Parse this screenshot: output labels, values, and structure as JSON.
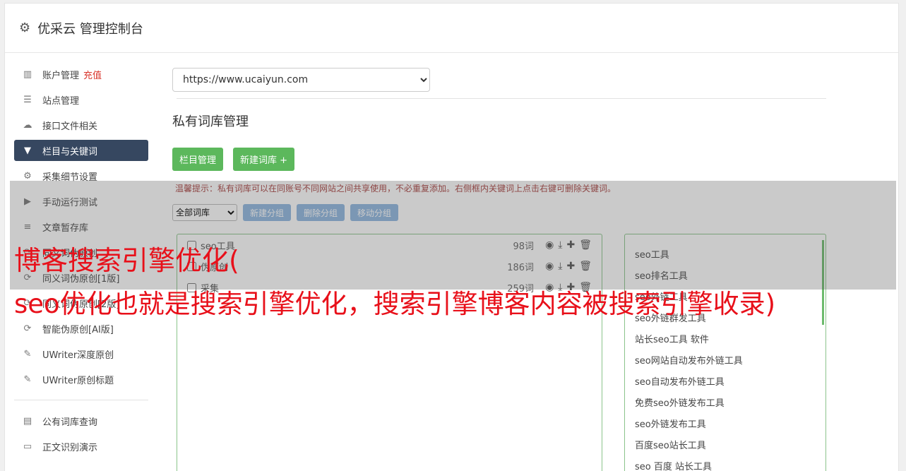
{
  "header": {
    "title": "优采云 管理控制台",
    "icon": "gear-icon"
  },
  "sidebar": {
    "items": [
      {
        "label": "账户管理",
        "badge": "充值",
        "icon": "bar-chart-icon"
      },
      {
        "label": "站点管理",
        "icon": "server-icon"
      },
      {
        "label": "接口文件相关",
        "icon": "cloud-upload-icon"
      },
      {
        "label": "栏目与关键词",
        "icon": "filter-icon",
        "active": true
      },
      {
        "label": "采集细节设置",
        "icon": "cogs-icon"
      },
      {
        "label": "手动运行测试",
        "icon": "play-icon"
      },
      {
        "label": "文章暂存库",
        "icon": "database-icon"
      },
      {
        "label": "同义词伪原创",
        "icon": "refresh-icon"
      },
      {
        "label": "同义词伪原创[1版]",
        "icon": "refresh-icon"
      },
      {
        "label": "同义词伪原创[2版]",
        "icon": "refresh-icon"
      },
      {
        "label": "智能伪原创[AI版]",
        "icon": "refresh-icon"
      },
      {
        "label": "UWriter深度原创",
        "icon": "edit-icon"
      },
      {
        "label": "UWriter原创标题",
        "icon": "edit-icon"
      }
    ],
    "items2": [
      {
        "label": "公有词库查询",
        "icon": "book-icon"
      },
      {
        "label": "正文识别演示",
        "icon": "monitor-icon"
      }
    ]
  },
  "main": {
    "site_select": "https://www.ucaiyun.com",
    "section_title": "私有词库管理",
    "btn_columns": "栏目管理",
    "btn_new_lib": "新建词库 +",
    "tip": "温馨提示：私有词库可以在同账号不同网站之间共享使用，不必重复添加。右侧框内关键词上点击右键可删除关键词。",
    "lib_select": "全部词库",
    "btn_new_group": "新建分组",
    "btn_delete_group": "删除分组",
    "btn_move_group": "移动分组"
  },
  "categories": [
    {
      "name": "seo工具",
      "count": "98词"
    },
    {
      "name": "伪原创",
      "count": "186词"
    },
    {
      "name": "采集",
      "count": "259词"
    }
  ],
  "keywords": [
    "seo工具",
    "seo排名工具",
    "seo外链工具",
    "seo外链群发工具",
    "站长seo工具 软件",
    "seo网站自动发布外链工具",
    "seo自动发布外链工具",
    "免费seo外链发布工具",
    "seo外链发布工具",
    "百度seo站长工具",
    "seo 百度 站长工具"
  ],
  "overlay": {
    "line1": "博客搜索引擎优化(",
    "line2": "seo优化也就是搜索引擎优化，搜索引擎博客内容被搜索引擎收录)"
  },
  "colors": {
    "active_nav": "#364760",
    "green": "#5cb85c",
    "blue": "#8fb6e0",
    "headline": "#e8101a"
  }
}
